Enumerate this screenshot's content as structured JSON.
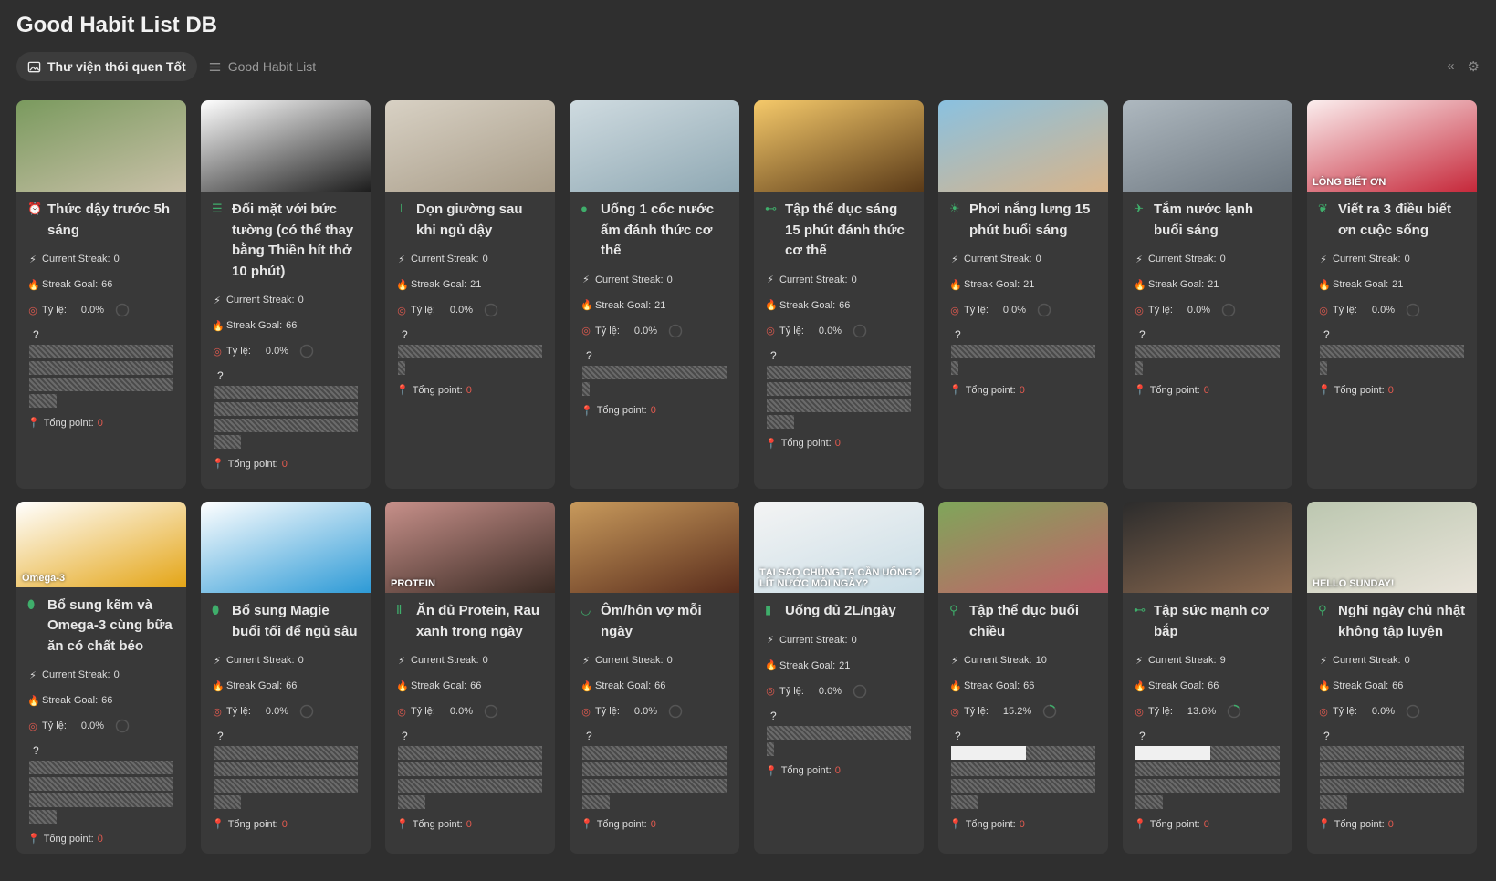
{
  "page": {
    "title": "Good Habit List DB"
  },
  "views": [
    {
      "label": "Thư viện thói quen Tốt",
      "icon": "image-icon",
      "active": true
    },
    {
      "label": "Good Habit List",
      "icon": "list-icon",
      "active": false
    }
  ],
  "labels": {
    "current_streak": "Current Streak:",
    "streak_goal": "Streak Goal:",
    "rate": "Tỷ lệ:",
    "total_point": "Tổng point:",
    "question": "?"
  },
  "colors": {
    "background": "#2f2f2f",
    "card": "#393939",
    "accent_green": "#3fae6b",
    "point_red": "#e35a4f"
  },
  "cards": [
    {
      "title": "Thức dậy trước 5h sáng",
      "icon": "alarm-icon",
      "current_streak": "0",
      "streak_goal": "66",
      "rate": "0.0%",
      "rate_fraction": 0,
      "total_point": "0",
      "cover": [
        "#7a9a5e",
        "#c9c0a8"
      ],
      "notes_lines": 4
    },
    {
      "title": "Đối mặt với bức tường (có thể thay bằng Thiền hít thở 10 phút)",
      "icon": "list-check-icon",
      "current_streak": "0",
      "streak_goal": "66",
      "rate": "0.0%",
      "rate_fraction": 0,
      "total_point": "0",
      "cover": [
        "#ffffff",
        "#1d1d1d"
      ],
      "notes_lines": 4
    },
    {
      "title": "Dọn giường sau khi ngủ dậy",
      "icon": "bed-icon",
      "current_streak": "0",
      "streak_goal": "21",
      "rate": "0.0%",
      "rate_fraction": 0,
      "total_point": "0",
      "cover": [
        "#d8d1c4",
        "#a89c88"
      ],
      "notes_lines": 2
    },
    {
      "title": "Uống 1 cốc nước ấm đánh thức cơ thể",
      "icon": "drop-icon",
      "current_streak": "0",
      "streak_goal": "21",
      "rate": "0.0%",
      "rate_fraction": 0,
      "total_point": "0",
      "cover": [
        "#cfdbe0",
        "#8fa8b3"
      ],
      "notes_lines": 2
    },
    {
      "title": "Tập thể dục sáng 15 phút đánh thức cơ thể",
      "icon": "dumbbell-icon",
      "current_streak": "0",
      "streak_goal": "66",
      "rate": "0.0%",
      "rate_fraction": 0,
      "total_point": "0",
      "cover": [
        "#f5c96a",
        "#5a3a18"
      ],
      "notes_lines": 4
    },
    {
      "title": "Phơi nắng lưng 15 phút buổi sáng",
      "icon": "sun-icon",
      "current_streak": "0",
      "streak_goal": "21",
      "rate": "0.0%",
      "rate_fraction": 0,
      "total_point": "0",
      "cover": [
        "#8ac1e0",
        "#d8b48a"
      ],
      "notes_lines": 2
    },
    {
      "title": "Tắm nước lạnh buổi sáng",
      "icon": "shower-icon",
      "current_streak": "0",
      "streak_goal": "21",
      "rate": "0.0%",
      "rate_fraction": 0,
      "total_point": "0",
      "cover": [
        "#aeb8bf",
        "#6d7780"
      ],
      "notes_lines": 2
    },
    {
      "title": "Viết ra 3 điều biết ơn cuộc sống",
      "icon": "heart-hand-icon",
      "current_streak": "0",
      "streak_goal": "21",
      "rate": "0.0%",
      "rate_fraction": 0,
      "total_point": "0",
      "cover": [
        "#fbeeee",
        "#c6283a"
      ],
      "cover_text": "LÒNG BIẾT ƠN",
      "notes_lines": 2
    },
    {
      "title": "Bổ sung kẽm và Omega-3 cùng bữa ăn có chất béo",
      "icon": "pill-icon",
      "current_streak": "0",
      "streak_goal": "66",
      "rate": "0.0%",
      "rate_fraction": 0,
      "total_point": "0",
      "cover": [
        "#ffffff",
        "#e4a516"
      ],
      "cover_text": "Omega-3",
      "notes_lines": 4
    },
    {
      "title": "Bổ sung Magie buổi tối để ngủ sâu",
      "icon": "pill-icon",
      "current_streak": "0",
      "streak_goal": "66",
      "rate": "0.0%",
      "rate_fraction": 0,
      "total_point": "0",
      "cover": [
        "#ffffff",
        "#2d9ad6"
      ],
      "notes_lines": 4
    },
    {
      "title": "Ăn đủ Protein, Rau xanh trong ngày",
      "icon": "fork-knife-icon",
      "current_streak": "0",
      "streak_goal": "66",
      "rate": "0.0%",
      "rate_fraction": 0,
      "total_point": "0",
      "cover": [
        "#c7908a",
        "#3b2b24"
      ],
      "cover_text": "PROTEIN",
      "notes_lines": 4
    },
    {
      "title": "Ôm/hôn vợ mỗi ngày",
      "icon": "lips-icon",
      "current_streak": "0",
      "streak_goal": "66",
      "rate": "0.0%",
      "rate_fraction": 0,
      "total_point": "0",
      "cover": [
        "#c89a5c",
        "#5a2d1c"
      ],
      "notes_lines": 4
    },
    {
      "title": "Uống đủ 2L/ngày",
      "icon": "bottle-icon",
      "current_streak": "0",
      "streak_goal": "21",
      "rate": "0.0%",
      "rate_fraction": 0,
      "total_point": "0",
      "cover": [
        "#f4f4f4",
        "#c9dde6"
      ],
      "cover_text": "TẠI SAO CHÚNG TA CẦN UỐNG 2 LÍT NƯỚC MỖI NGÀY?",
      "notes_lines": 2
    },
    {
      "title": "Tập thể dục buổi chiều",
      "icon": "running-icon",
      "current_streak": "10",
      "streak_goal": "66",
      "rate": "15.2%",
      "rate_fraction": 0.152,
      "total_point": "0",
      "cover": [
        "#7fa65a",
        "#c4606a"
      ],
      "notes_lines": 4,
      "notes_progress": true
    },
    {
      "title": "Tập sức mạnh cơ bắp",
      "icon": "dumbbell-icon",
      "current_streak": "9",
      "streak_goal": "66",
      "rate": "13.6%",
      "rate_fraction": 0.136,
      "total_point": "0",
      "cover": [
        "#2c2c2c",
        "#8c6a50"
      ],
      "notes_lines": 4,
      "notes_progress": true
    },
    {
      "title": "Nghỉ ngày chủ nhật không tập luyện",
      "icon": "running-icon",
      "current_streak": "0",
      "streak_goal": "66",
      "rate": "0.0%",
      "rate_fraction": 0,
      "total_point": "0",
      "cover": [
        "#bcc7b0",
        "#e9e4da"
      ],
      "cover_text": "HELLO SUNDAY!",
      "notes_lines": 4
    }
  ]
}
